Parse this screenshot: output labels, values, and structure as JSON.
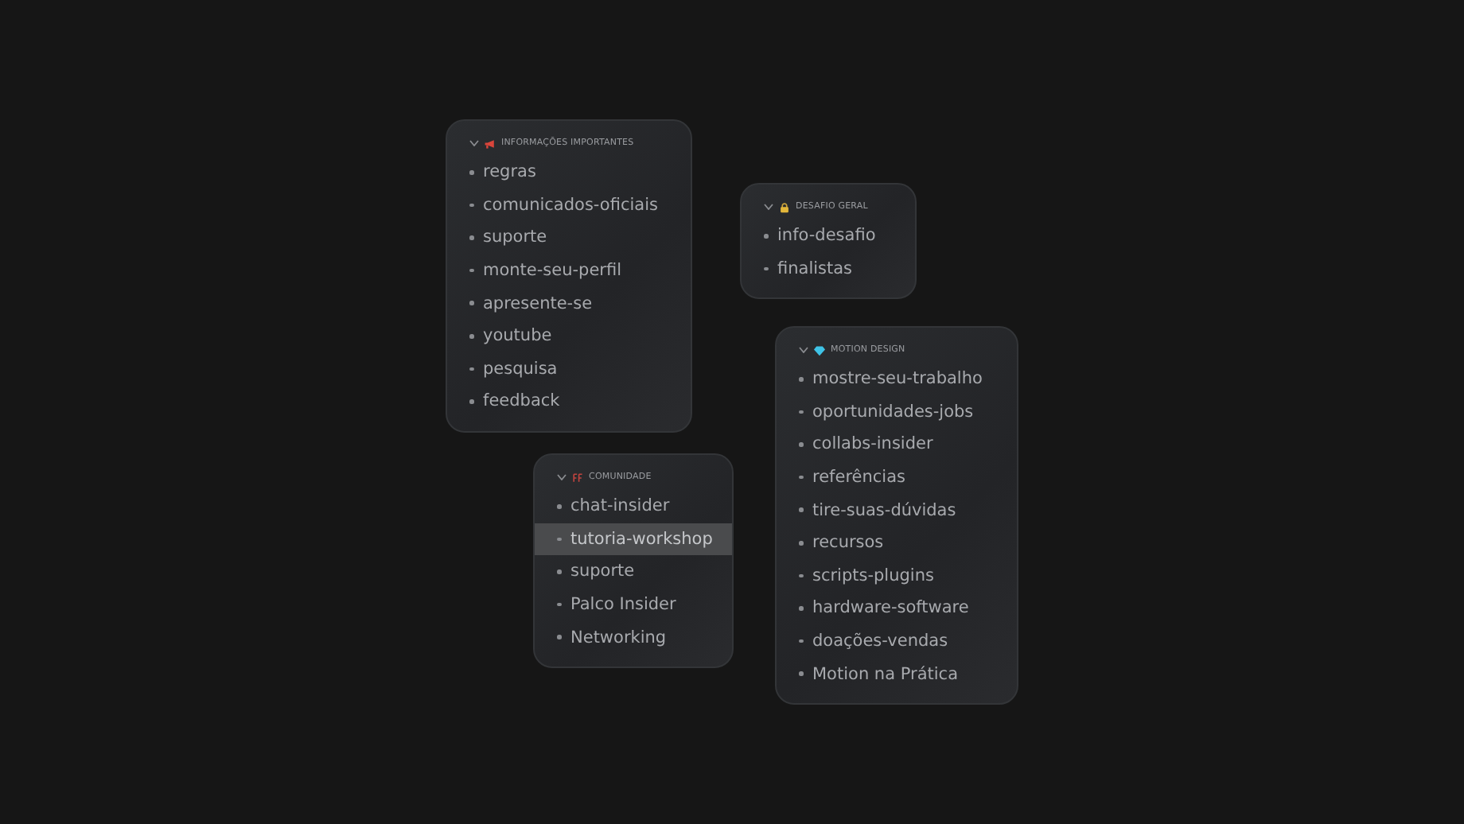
{
  "categories": [
    {
      "title": "INFORMAÇÕES IMPORTANTES",
      "kind": "megaphone",
      "expanded": true,
      "items": [
        {
          "label": "regras",
          "selected": false
        },
        {
          "label": "comunicados-oficiais",
          "selected": false
        },
        {
          "label": "suporte",
          "selected": false
        },
        {
          "label": "monte-seu-perfil",
          "selected": false
        },
        {
          "label": "apresente-se",
          "selected": false
        },
        {
          "label": "youtube",
          "selected": false
        },
        {
          "label": "pesquisa",
          "selected": false
        },
        {
          "label": "feedback",
          "selected": false
        }
      ]
    },
    {
      "title": "DESAFIO GERAL",
      "kind": "lock",
      "expanded": true,
      "items": [
        {
          "label": "info-desafio",
          "selected": false
        },
        {
          "label": "finalistas",
          "selected": false
        }
      ]
    },
    {
      "title": "COMUNIDADE",
      "kind": "marks",
      "expanded": true,
      "items": [
        {
          "label": "chat-insider",
          "selected": false
        },
        {
          "label": "tutoria-workshop",
          "selected": true
        },
        {
          "label": "suporte",
          "selected": false
        },
        {
          "label": "Palco Insider",
          "selected": false
        },
        {
          "label": "Networking",
          "selected": false
        }
      ]
    },
    {
      "title": "MOTION DESIGN",
      "kind": "gem",
      "expanded": true,
      "items": [
        {
          "label": "mostre-seu-trabalho",
          "selected": false
        },
        {
          "label": "oportunidades-jobs",
          "selected": false
        },
        {
          "label": "collabs-insider",
          "selected": false
        },
        {
          "label": "referências",
          "selected": false
        },
        {
          "label": "tire-suas-dúvidas",
          "selected": false
        },
        {
          "label": "recursos",
          "selected": false
        },
        {
          "label": "scripts-plugins",
          "selected": false
        },
        {
          "label": "hardware-software",
          "selected": false
        },
        {
          "label": "doações-vendas",
          "selected": false
        },
        {
          "label": "Motion na Prática",
          "selected": false
        }
      ]
    }
  ]
}
